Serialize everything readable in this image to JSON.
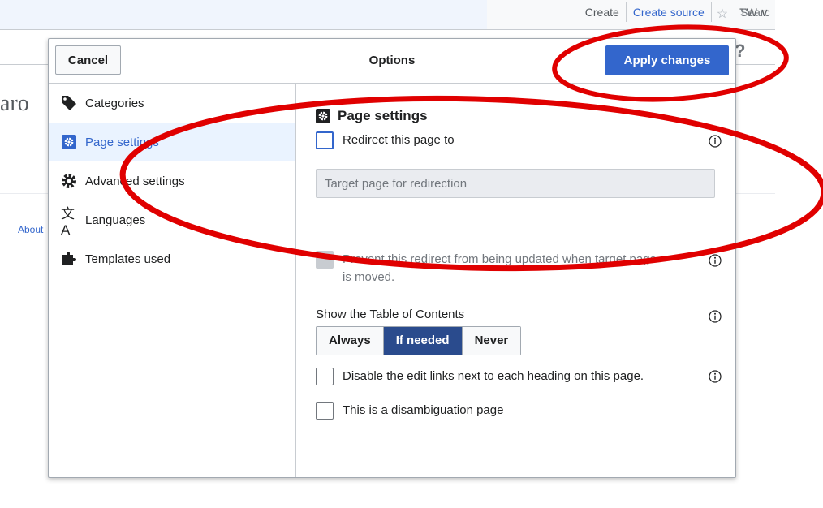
{
  "background": {
    "tabs": [
      {
        "label": "Create",
        "link": false
      },
      {
        "label": "Create source",
        "link": true
      }
    ],
    "star_icon": "star-outline-icon",
    "tw_menu_label": "TW ∨",
    "search_placeholder": "Searc",
    "title_fragment": "aro",
    "about_link": "About",
    "help_label": "?"
  },
  "dialog": {
    "title": "Options",
    "cancel_label": "Cancel",
    "apply_label": "Apply changes",
    "sidebar": {
      "items": [
        {
          "label": "Categories",
          "icon": "tag-icon",
          "active": false
        },
        {
          "label": "Page settings",
          "icon": "page-settings-icon",
          "active": true
        },
        {
          "label": "Advanced settings",
          "icon": "gear-icon",
          "active": false
        },
        {
          "label": "Languages",
          "icon": "language-icon",
          "active": false
        },
        {
          "label": "Templates used",
          "icon": "puzzle-icon",
          "active": false
        }
      ]
    },
    "page_settings": {
      "title": "Page settings",
      "redirect_label": "Redirect this page to",
      "redirect_target_placeholder": "Target page for redirection",
      "prevent_redirect_label_line1": "Prevent this redirect from being updated when target page",
      "prevent_redirect_label_line2": "is moved.",
      "toc_label": "Show the Table of Contents",
      "toc_options": [
        "Always",
        "If needed",
        "Never"
      ],
      "toc_selected": "If needed",
      "disable_edit_links_label": "Disable the edit links next to each heading on this page.",
      "disambiguation_label": "This is a disambiguation page"
    }
  },
  "colors": {
    "accent": "#3366cc",
    "segment_selected": "#2a4b8d",
    "annotation": "#e00000"
  }
}
